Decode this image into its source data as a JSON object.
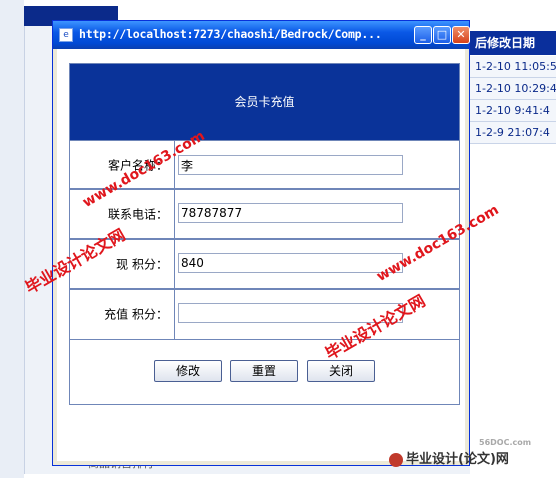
{
  "window": {
    "title": "http://localhost:7273/chaoshi/Bedrock/Comp..."
  },
  "background": {
    "right_header": "后修改日期",
    "right_rows": [
      "1-2-10 11:05:5",
      "1-2-10 10:29:4",
      "1-2-10 9:41:4",
      "1-2-9 21:07:4"
    ],
    "bottom_text": "商品销售排行"
  },
  "form": {
    "header": "会员卡充值",
    "fields": [
      {
        "label": "客户名称：",
        "value": "李"
      },
      {
        "label": "联系电话：",
        "value": "78787877"
      },
      {
        "label": "现  积分：",
        "value": "840"
      },
      {
        "label": "充值 积分：",
        "value": ""
      }
    ],
    "buttons": {
      "edit": "修改",
      "reset": "重置",
      "close": "关闭"
    }
  },
  "watermarks": {
    "text1": "毕业设计论文网",
    "text2": "www.doc163.com",
    "bottom_brand": "毕业设计(论文)网",
    "bottom_site": "56DOC.com"
  },
  "colors": {
    "header_blue": "#0a3399",
    "watermark_red": "#e0161c",
    "titlebar_blue": "#0a58e6"
  },
  "icons": [
    "ie-page-icon",
    "minimize-icon",
    "maximize-icon",
    "close-icon"
  ]
}
